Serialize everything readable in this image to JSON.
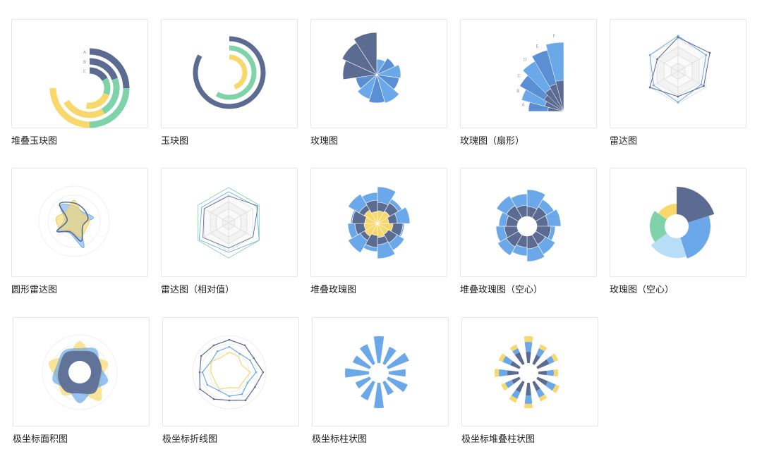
{
  "colors": {
    "navy": "#5b6b91",
    "green": "#7fd3a8",
    "yellow": "#f8d86b",
    "blue": "#6aa8ea",
    "blue_mid": "#5b8fd3",
    "light_blue": "#b7ddf7",
    "grid": "#e4e4e4"
  },
  "gallery": {
    "items": [
      {
        "label": "堆叠玉玦图",
        "icon": "stacked-jade-chart-icon"
      },
      {
        "label": "玉玦图",
        "icon": "jade-chart-icon"
      },
      {
        "label": "玫瑰图",
        "icon": "rose-chart-icon"
      },
      {
        "label": "玫瑰图（扇形）",
        "icon": "rose-sector-chart-icon",
        "axis_letters": [
          "A",
          "B",
          "C",
          "D",
          "E",
          "F"
        ]
      },
      {
        "label": "雷达图",
        "icon": "radar-chart-icon"
      },
      {
        "label": "圆形雷达图",
        "icon": "circular-radar-chart-icon"
      },
      {
        "label": "雷达图（相对值）",
        "icon": "relative-radar-chart-icon"
      },
      {
        "label": "堆叠玫瑰图",
        "icon": "stacked-rose-chart-icon"
      },
      {
        "label": "堆叠玫瑰图（空心）",
        "icon": "hollow-stacked-rose-chart-icon"
      },
      {
        "label": "玫瑰图（空心）",
        "icon": "hollow-rose-chart-icon"
      },
      {
        "label": "极坐标面积图",
        "icon": "polar-area-chart-icon"
      },
      {
        "label": "极坐标折线图",
        "icon": "polar-line-chart-icon"
      },
      {
        "label": "极坐标柱状图",
        "icon": "polar-bar-chart-icon"
      },
      {
        "label": "极坐标堆叠柱状图",
        "icon": "polar-stacked-bar-chart-icon"
      }
    ]
  },
  "stacked_jade": {
    "letters": [
      "A",
      "B",
      "C"
    ]
  }
}
